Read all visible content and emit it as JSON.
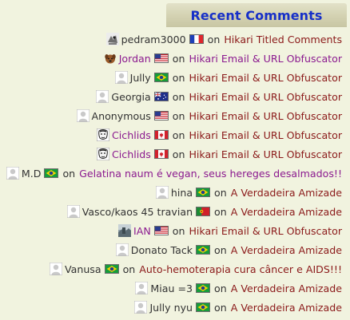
{
  "widget": {
    "title": "Recent Comments"
  },
  "on_label": "on",
  "comments": [
    {
      "author": "pedram3000",
      "author_link": false,
      "avatar": "sketch-avatar-icon",
      "flag": "france-flag-icon",
      "post": "Hikari Titled Comments",
      "post_style": "normal"
    },
    {
      "author": "Jordan",
      "author_link": true,
      "avatar": "dog-avatar-icon",
      "flag": "usa-flag-icon",
      "post": "Hikari Email & URL Obfuscator",
      "post_style": "alt"
    },
    {
      "author": "Jully",
      "author_link": false,
      "avatar": "default-avatar-icon",
      "flag": "brazil-flag-icon",
      "post": "Hikari Email & URL Obfuscator",
      "post_style": "normal"
    },
    {
      "author": "Georgia",
      "author_link": false,
      "avatar": "default-avatar-icon",
      "flag": "australia-flag-icon",
      "post": "Hikari Email & URL Obfuscator",
      "post_style": "normal"
    },
    {
      "author": "Anonymous",
      "author_link": false,
      "avatar": "default-avatar-icon",
      "flag": "usa-flag-icon",
      "post": "Hikari Email & URL Obfuscator",
      "post_style": "normal"
    },
    {
      "author": "Cichlids",
      "author_link": true,
      "avatar": "face-sketch-avatar-icon",
      "flag": "canada-flag-icon",
      "post": "Hikari Email & URL Obfuscator",
      "post_style": "normal"
    },
    {
      "author": "Cichlids",
      "author_link": true,
      "avatar": "face-sketch-avatar-icon",
      "flag": "canada-flag-icon",
      "post": "Hikari Email & URL Obfuscator",
      "post_style": "normal"
    },
    {
      "author": "M.D",
      "author_link": false,
      "avatar": "default-avatar-icon",
      "flag": "brazil-flag-icon",
      "post": "Gelatina naum é vegan, seus hereges desalmados!!",
      "post_style": "alt"
    },
    {
      "author": "hina",
      "author_link": false,
      "avatar": "default-avatar-icon",
      "flag": "brazil-flag-icon",
      "post": "A Verdadeira Amizade",
      "post_style": "normal"
    },
    {
      "author": "Vasco/kaos 45 travian",
      "author_link": false,
      "avatar": "default-avatar-icon",
      "flag": "portugal-flag-icon",
      "post": "A Verdadeira Amizade",
      "post_style": "normal"
    },
    {
      "author": "IAN",
      "author_link": true,
      "avatar": "photo-avatar-icon",
      "flag": "usa-flag-icon",
      "post": "Hikari Email & URL Obfuscator",
      "post_style": "normal"
    },
    {
      "author": "Donato Tack",
      "author_link": false,
      "avatar": "default-avatar-icon",
      "flag": "brazil-flag-icon",
      "post": "A Verdadeira Amizade",
      "post_style": "normal"
    },
    {
      "author": "Vanusa",
      "author_link": false,
      "avatar": "default-avatar-icon",
      "flag": "brazil-flag-icon",
      "post": "Auto-hemoterapia cura câncer e AIDS!!!",
      "post_style": "normal"
    },
    {
      "author": "Miau =3",
      "author_link": false,
      "avatar": "default-avatar-icon",
      "flag": "brazil-flag-icon",
      "post": "A Verdadeira Amizade",
      "post_style": "normal"
    },
    {
      "author": "Jully nyu",
      "author_link": false,
      "avatar": "default-avatar-icon",
      "flag": "brazil-flag-icon",
      "post": "A Verdadeira Amizade",
      "post_style": "normal"
    }
  ]
}
